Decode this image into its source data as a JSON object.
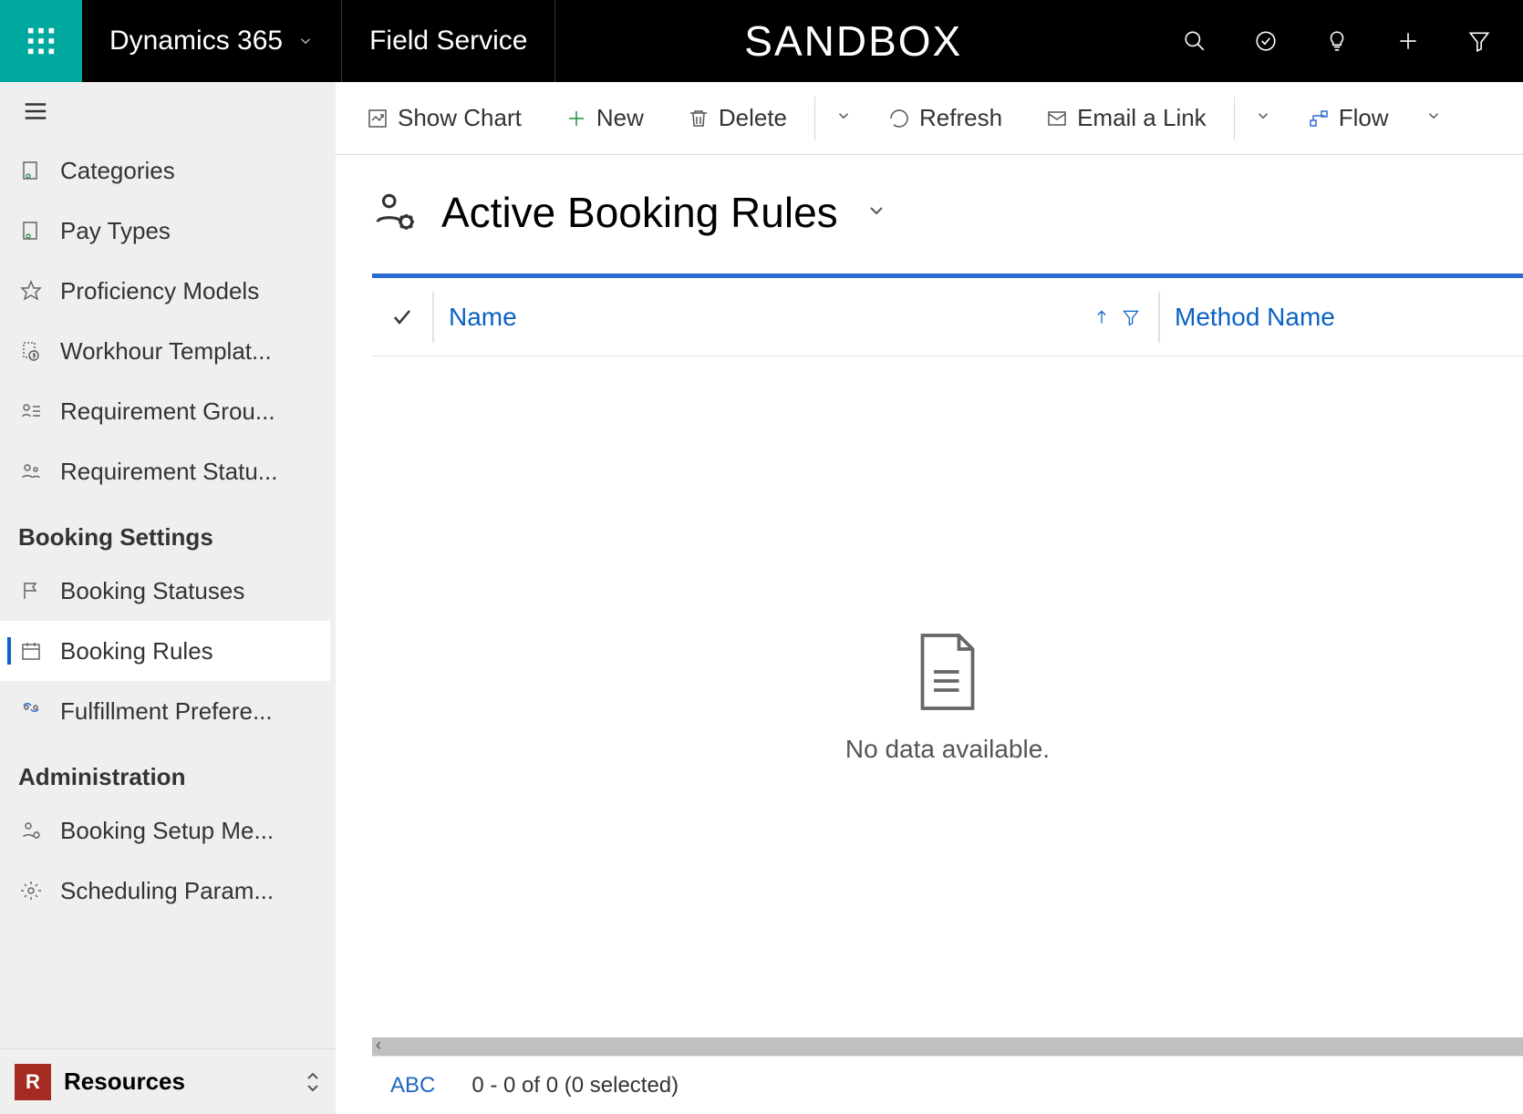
{
  "topbar": {
    "brand": "Dynamics 365",
    "module": "Field Service",
    "environment": "SANDBOX"
  },
  "sidebar": {
    "items": [
      {
        "label": "Categories",
        "active": false
      },
      {
        "label": "Pay Types",
        "active": false
      },
      {
        "label": "Proficiency Models",
        "active": false
      },
      {
        "label": "Workhour Templat...",
        "active": false
      },
      {
        "label": "Requirement Grou...",
        "active": false
      },
      {
        "label": "Requirement Statu...",
        "active": false
      }
    ],
    "group_booking": "Booking Settings",
    "booking_items": [
      {
        "label": "Booking Statuses",
        "active": false
      },
      {
        "label": "Booking Rules",
        "active": true
      },
      {
        "label": "Fulfillment Prefere...",
        "active": false
      }
    ],
    "group_admin": "Administration",
    "admin_items": [
      {
        "label": "Booking Setup Me...",
        "active": false
      },
      {
        "label": "Scheduling Param...",
        "active": false
      }
    ],
    "footer_avatar": "R",
    "footer_label": "Resources"
  },
  "commands": {
    "show_chart": "Show Chart",
    "new": "New",
    "delete": "Delete",
    "refresh": "Refresh",
    "email_link": "Email a Link",
    "flow": "Flow"
  },
  "view": {
    "title": "Active Booking Rules",
    "columns": {
      "name": "Name",
      "method": "Method Name"
    },
    "empty": "No data available."
  },
  "footer": {
    "abc": "ABC",
    "paging": "0 - 0 of 0 (0 selected)"
  }
}
